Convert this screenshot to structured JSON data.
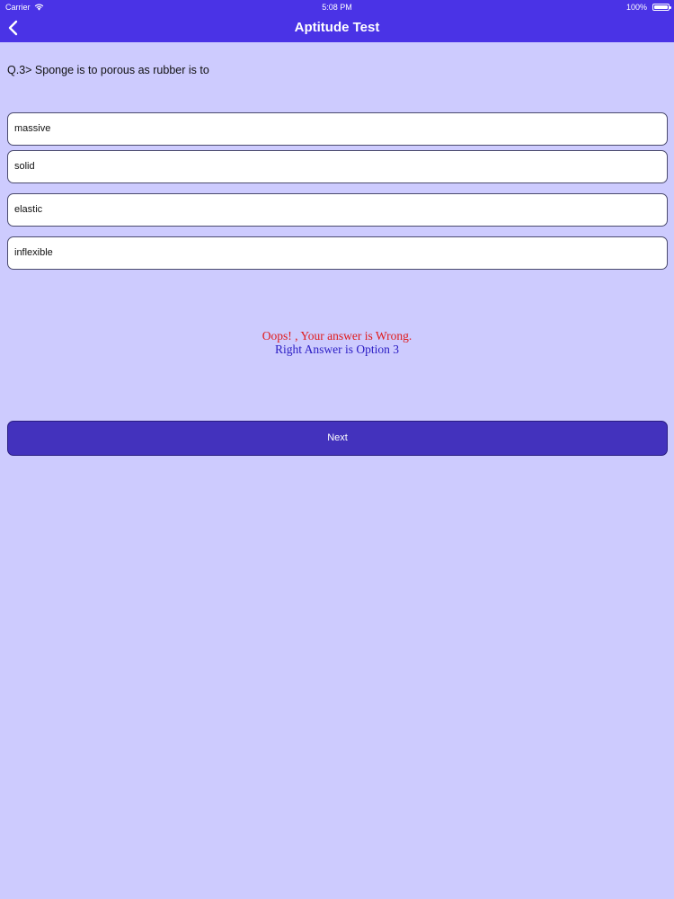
{
  "status_bar": {
    "carrier": "Carrier",
    "time": "5:08 PM",
    "battery": "100%"
  },
  "header": {
    "title": "Aptitude Test",
    "back_icon": "chevron-left-icon"
  },
  "question": {
    "text": "Q.3> Sponge is to porous as rubber is to"
  },
  "options": [
    {
      "label": "massive"
    },
    {
      "label": "solid"
    },
    {
      "label": "elastic"
    },
    {
      "label": "inflexible"
    }
  ],
  "result": {
    "wrong_text": "Oops! , Your answer is Wrong.",
    "right_text": "Right Answer is Option 3",
    "wrong_color": "#e11a1a",
    "right_color": "#2a1cc4"
  },
  "next_button": {
    "label": "Next"
  },
  "colors": {
    "accent": "#4a33e6",
    "background": "#cdcbfe",
    "button": "#4332bd"
  }
}
